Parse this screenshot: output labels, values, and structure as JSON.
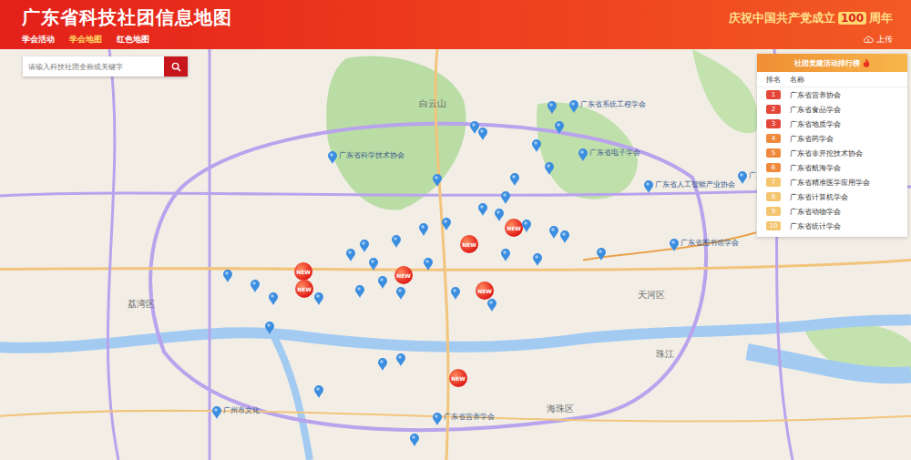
{
  "header": {
    "title": "广东省科技社团信息地图",
    "celebration": {
      "prefix": "庆祝中国共产党成立",
      "number": "100",
      "suffix": "周年"
    },
    "nav": [
      {
        "label": "学会活动",
        "selected": false
      },
      {
        "label": "学会地图",
        "selected": true
      },
      {
        "label": "红色地图",
        "selected": false
      }
    ],
    "upload": "上传"
  },
  "search": {
    "placeholder": "请输入科技社团全称或关键字"
  },
  "ranking": {
    "title": "社团党建活动排行榜",
    "columns": [
      "排名",
      "名称"
    ],
    "rows": [
      {
        "rank": "1",
        "name": "广东省营养协会",
        "color": "#e5463a"
      },
      {
        "rank": "2",
        "name": "广东省食品学会",
        "color": "#e5463a"
      },
      {
        "rank": "3",
        "name": "广东省地质学会",
        "color": "#e5463a"
      },
      {
        "rank": "4",
        "name": "广东省药学会",
        "color": "#ef8a3c"
      },
      {
        "rank": "5",
        "name": "广东省非开挖技术协会",
        "color": "#ef8a3c"
      },
      {
        "rank": "6",
        "name": "广东省航海学会",
        "color": "#ef8a3c"
      },
      {
        "rank": "7",
        "name": "广东省精准医学应用学会",
        "color": "#f4c46e"
      },
      {
        "rank": "8",
        "name": "广东省计算机学会",
        "color": "#f4c46e"
      },
      {
        "rank": "9",
        "name": "广东省动物学会",
        "color": "#f4c46e"
      },
      {
        "rank": "10",
        "name": "广东省统计学会",
        "color": "#f4c46e"
      }
    ]
  },
  "map": {
    "places": [
      "白云山",
      "天河区",
      "荔湾区",
      "珠江",
      "海珠区"
    ],
    "pins": [
      {
        "kind": "new",
        "label": "NEW"
      },
      {
        "kind": "new",
        "label": "NEW"
      },
      {
        "kind": "new",
        "label": "NEW"
      },
      {
        "kind": "new",
        "label": "NEW"
      },
      {
        "kind": "new",
        "label": "NEW"
      },
      {
        "kind": "new",
        "label": "NEW"
      },
      {
        "kind": "new",
        "label": "NEW"
      },
      {
        "kind": "pin",
        "label": "广东省系统工程学会"
      },
      {
        "kind": "pin",
        "label": ""
      },
      {
        "kind": "pin",
        "label": ""
      },
      {
        "kind": "pin",
        "label": ""
      },
      {
        "kind": "pin",
        "label": ""
      },
      {
        "kind": "pin",
        "label": ""
      },
      {
        "kind": "pin",
        "label": ""
      },
      {
        "kind": "pin",
        "label": ""
      },
      {
        "kind": "pin",
        "label": ""
      },
      {
        "kind": "pin",
        "label": ""
      },
      {
        "kind": "pin",
        "label": ""
      },
      {
        "kind": "pin",
        "label": ""
      },
      {
        "kind": "pin",
        "label": ""
      },
      {
        "kind": "pin",
        "label": ""
      },
      {
        "kind": "pin",
        "label": ""
      },
      {
        "kind": "pin",
        "label": ""
      },
      {
        "kind": "pin",
        "label": ""
      },
      {
        "kind": "pin",
        "label": ""
      },
      {
        "kind": "pin",
        "label": ""
      },
      {
        "kind": "pin",
        "label": ""
      },
      {
        "kind": "pin",
        "label": ""
      },
      {
        "kind": "pin",
        "label": ""
      },
      {
        "kind": "pin",
        "label": ""
      },
      {
        "kind": "pin",
        "label": ""
      },
      {
        "kind": "pin",
        "label": ""
      },
      {
        "kind": "pin",
        "label": ""
      },
      {
        "kind": "pin",
        "label": ""
      },
      {
        "kind": "pin",
        "label": ""
      },
      {
        "kind": "pin",
        "label": ""
      },
      {
        "kind": "pin",
        "label": ""
      },
      {
        "kind": "pin",
        "label": ""
      },
      {
        "kind": "pin",
        "label": ""
      },
      {
        "kind": "pin",
        "label": ""
      },
      {
        "kind": "pin",
        "label": "广州市文化"
      },
      {
        "kind": "pin",
        "label": ""
      },
      {
        "kind": "pin",
        "label": ""
      },
      {
        "kind": "pin",
        "label": ""
      },
      {
        "kind": "pin",
        "label": ""
      },
      {
        "kind": "pin",
        "label": ""
      },
      {
        "kind": "pin",
        "label": "广东省营养学会"
      },
      {
        "kind": "pin",
        "label": "广东省人工智能产业协会"
      },
      {
        "kind": "pin",
        "label": "广东省图书馆学会"
      },
      {
        "kind": "pin",
        "label": "广东省林学会"
      },
      {
        "kind": "pin",
        "label": ""
      },
      {
        "kind": "pin",
        "label": "广东省电子学会"
      },
      {
        "kind": "pin",
        "label": "广东省科学技术协会"
      }
    ]
  }
}
